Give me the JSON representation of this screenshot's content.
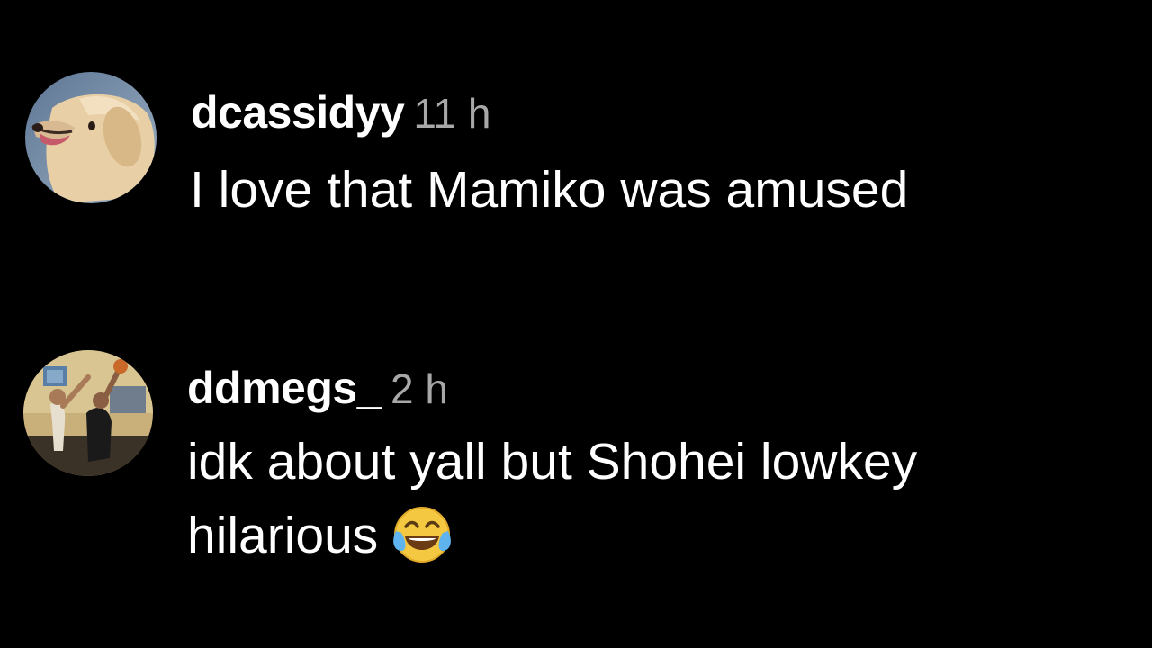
{
  "comments": [
    {
      "username": "dcassidyy",
      "time": "11 h",
      "text": "I love that Mamiko was amused",
      "avatar_icon": "dog-avatar-icon",
      "emoji": ""
    },
    {
      "username": "ddmegs_",
      "time": "2 h",
      "text": "idk about yall but Shohei lowkey\nhilarious",
      "avatar_icon": "basketball-avatar-icon",
      "emoji": "😂"
    }
  ],
  "colors": {
    "background": "#000000",
    "text": "#ffffff",
    "timestamp": "#a8a8a8"
  }
}
